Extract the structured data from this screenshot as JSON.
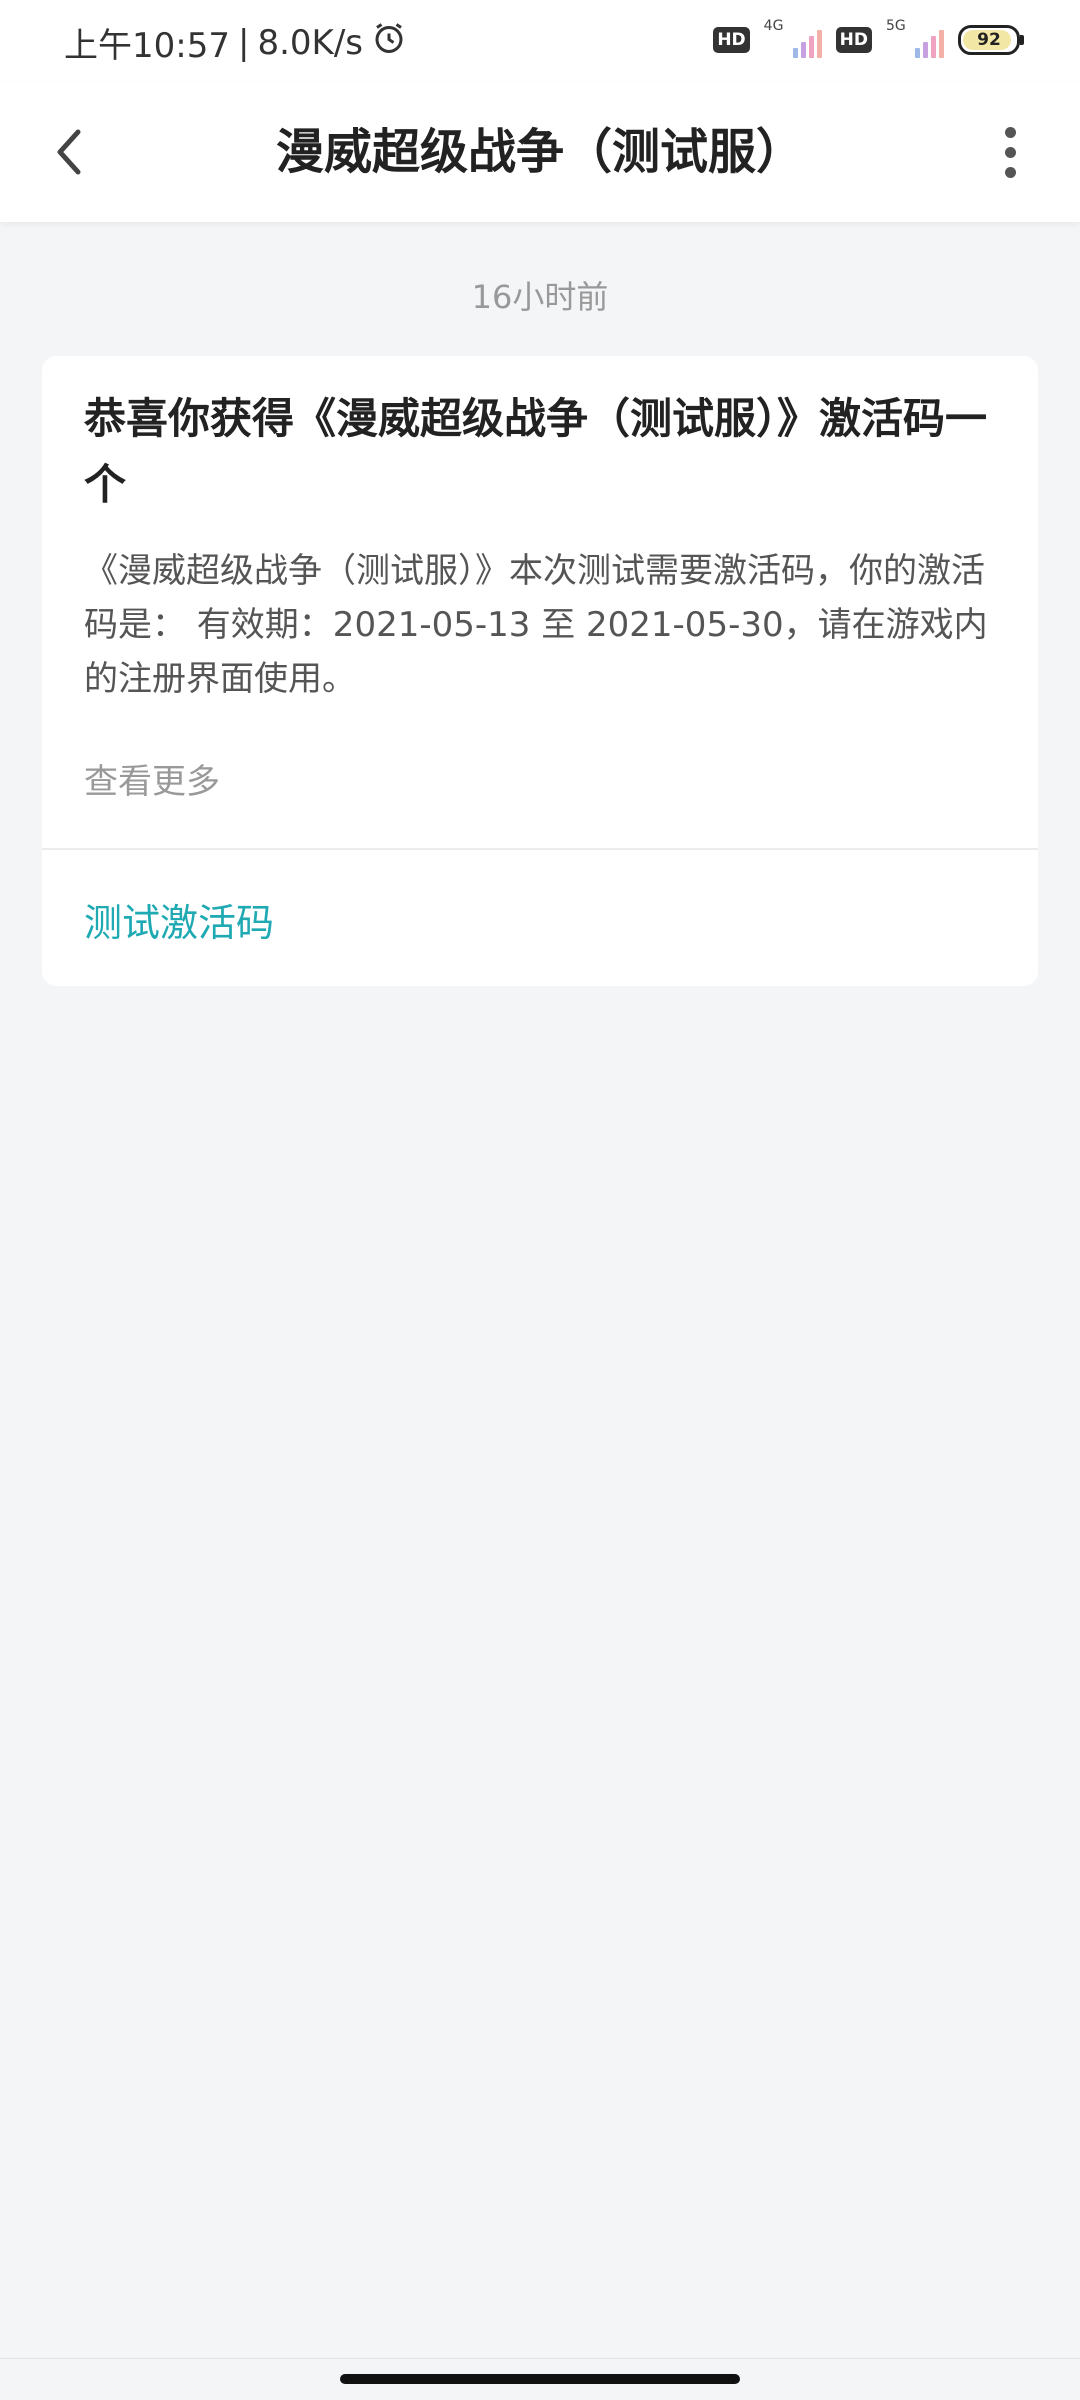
{
  "status_bar": {
    "time": "上午10:57",
    "separator": "|",
    "net_speed": "8.0K/s",
    "alarm_icon": "alarm-clock-icon",
    "sim1": {
      "badge": "HD",
      "generation": "4G"
    },
    "sim2": {
      "badge": "HD",
      "generation": "5G"
    },
    "battery_percent": "92",
    "battery_level": 0.92
  },
  "nav": {
    "back_icon": "chevron-left-icon",
    "title": "漫威超级战争（测试服）",
    "more_icon": "more-vertical-icon"
  },
  "message": {
    "timestamp": "16小时前",
    "title": "恭喜你获得《漫威超级战争（测试服）》激活码一个",
    "body": "《漫威超级战争（测试服）》本次测试需要激活码，你的激活码是：                     有效期：2021-05-13 至 2021-05-30，请在游戏内的注册界面使用。",
    "more_label": "查看更多",
    "action_label": "测试激活码"
  },
  "colors": {
    "accent": "#1fa9b3",
    "background": "#f4f5f7",
    "card": "#ffffff"
  }
}
